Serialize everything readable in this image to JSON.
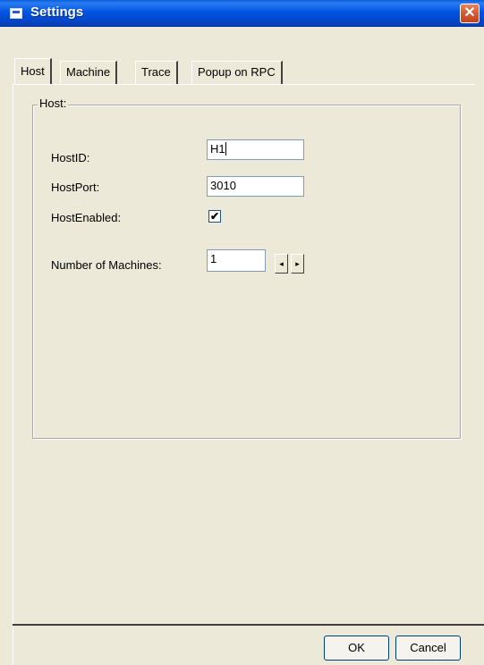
{
  "window": {
    "title": "Settings"
  },
  "tabs": [
    {
      "label": "Host"
    },
    {
      "label": "Machine"
    },
    {
      "label": "Trace"
    },
    {
      "label": "Popup on RPC"
    }
  ],
  "group": {
    "legend": "Host:"
  },
  "fields": {
    "host_id": {
      "label": "HostID:",
      "value": "H1"
    },
    "host_port": {
      "label": "HostPort:",
      "value": "3010"
    },
    "host_enabled": {
      "label": "HostEnabled:",
      "checked": true,
      "mark": "✔"
    },
    "num_machines": {
      "label": "Number of Machines:",
      "value": "1"
    }
  },
  "spin": {
    "left": "◂",
    "right": "▸"
  },
  "buttons": {
    "ok": "OK",
    "cancel": "Cancel"
  },
  "icons": {
    "close": "✕"
  }
}
